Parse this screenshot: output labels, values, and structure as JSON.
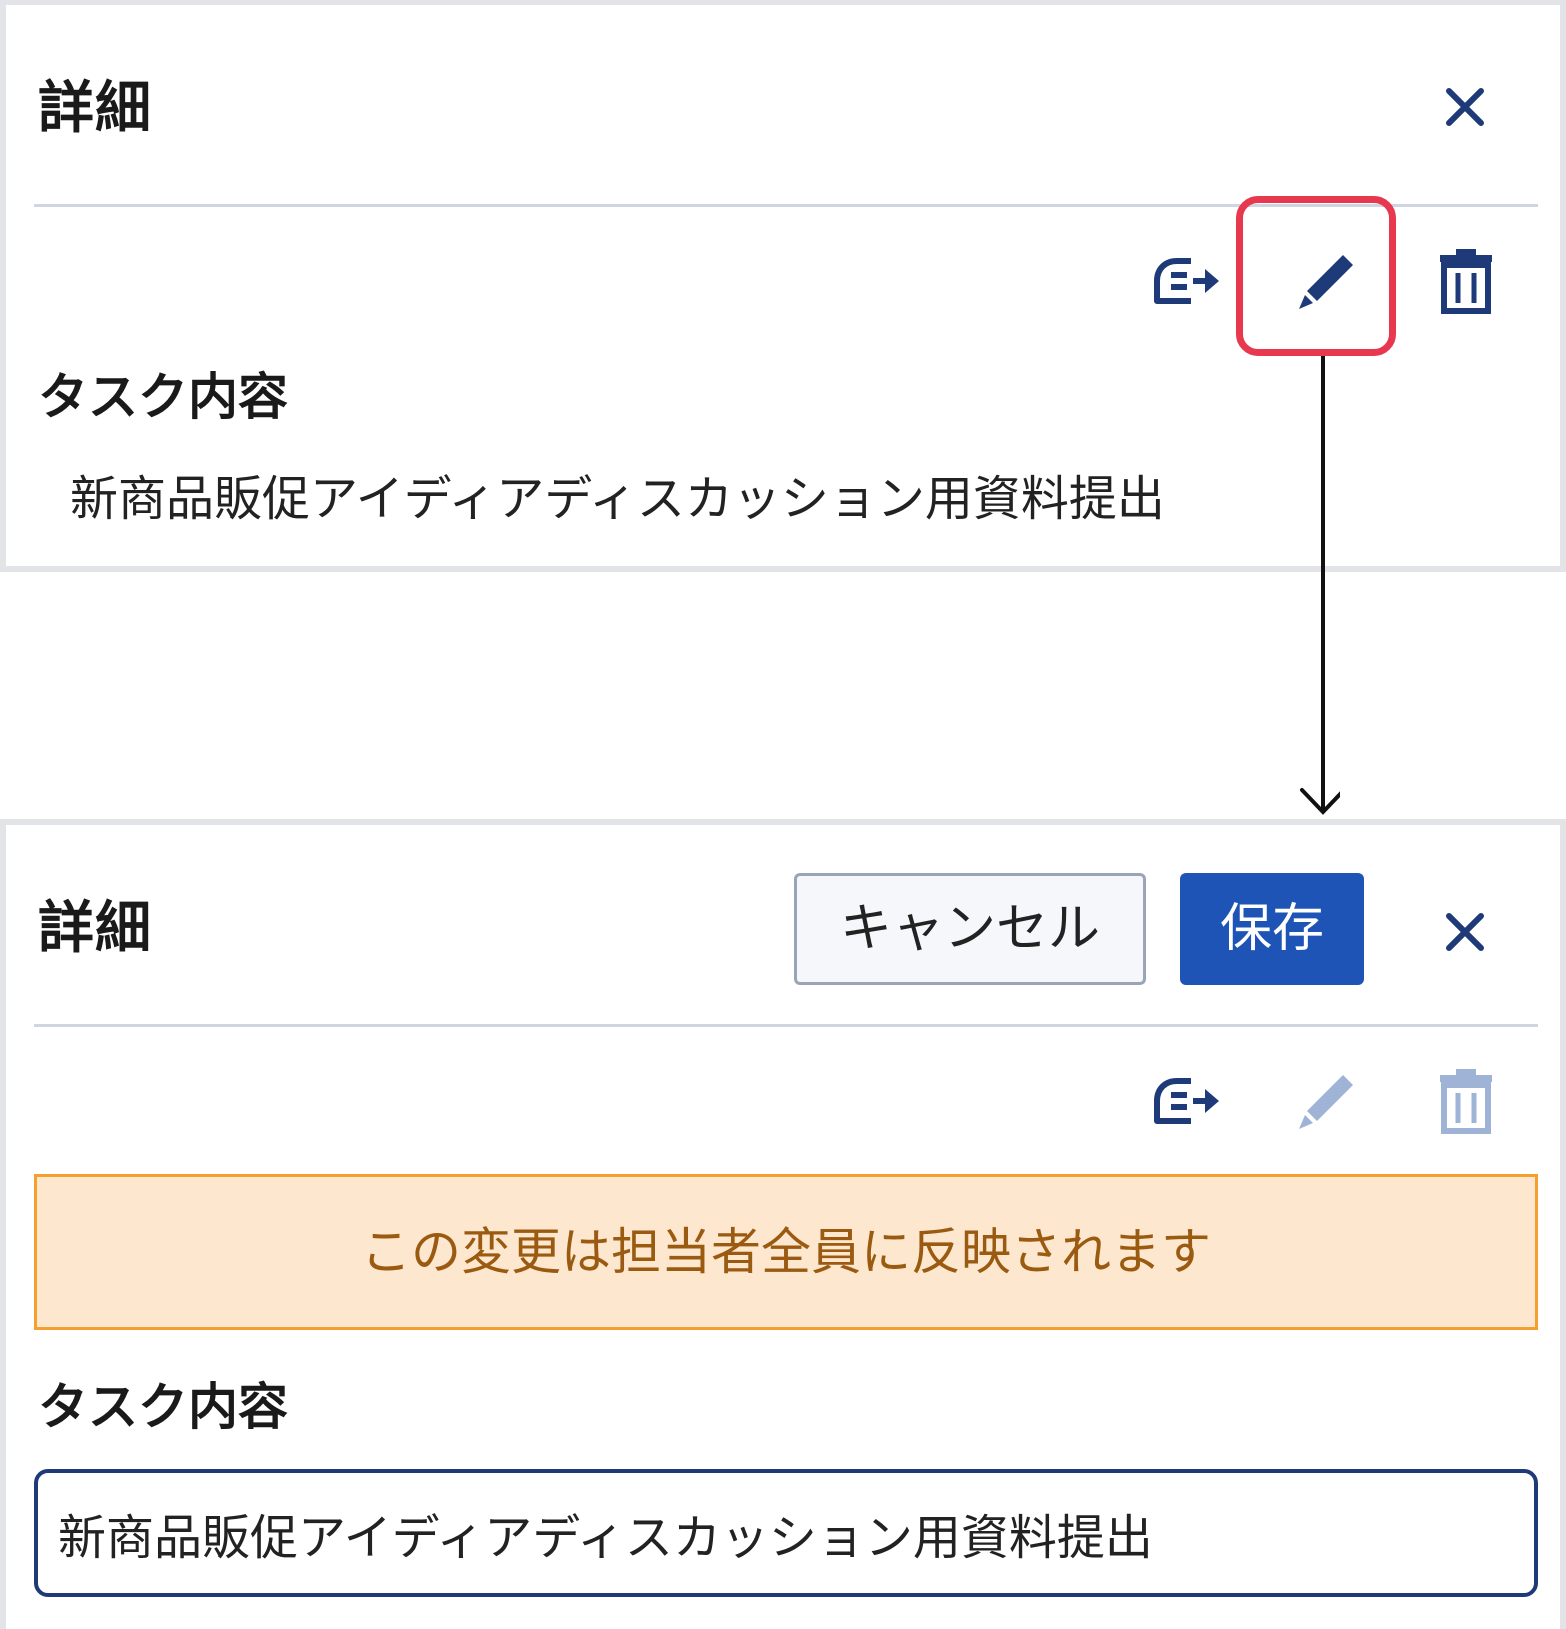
{
  "view_panel": {
    "title": "詳細",
    "section_label": "タスク内容",
    "task_content": "新商品販促アイディアディスカッション用資料提出"
  },
  "edit_panel": {
    "title": "詳細",
    "cancel_label": "キャンセル",
    "save_label": "保存",
    "notice": "この変更は担当者全員に反映されます",
    "section_label": "タスク内容",
    "task_input_value": "新商品販促アイディアディスカッション用資料提出"
  },
  "icons": {
    "close": "close-icon",
    "share": "share-arrow-icon",
    "edit": "pencil-icon",
    "delete": "trash-icon"
  },
  "colors": {
    "icon_active": "#1f3a78",
    "icon_disabled": "#9fb3d6",
    "highlight": "#e8384f",
    "save_button": "#1d54b5",
    "notice_bg": "#fde7cf",
    "notice_border": "#f5a02e",
    "notice_text": "#9a5a10"
  }
}
